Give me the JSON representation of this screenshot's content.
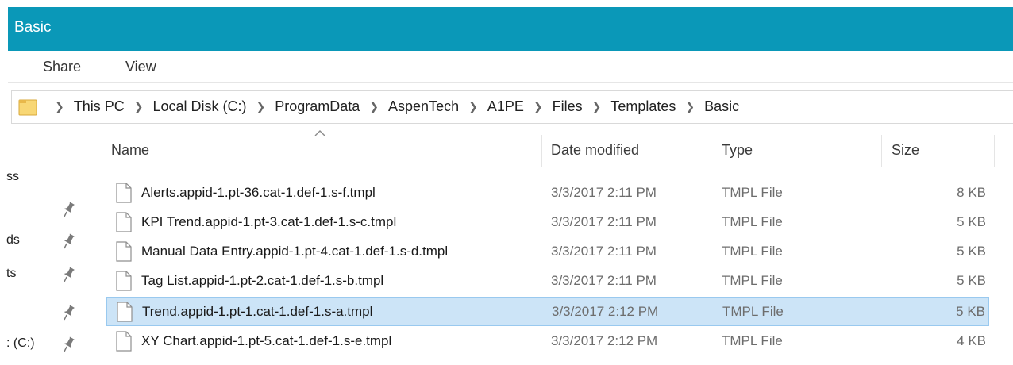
{
  "window": {
    "title": "Basic"
  },
  "ribbon": {
    "tabs": [
      "Share",
      "View"
    ]
  },
  "address": {
    "crumbs": [
      "This PC",
      "Local Disk (C:)",
      "ProgramData",
      "AspenTech",
      "A1PE",
      "Files",
      "Templates",
      "Basic"
    ]
  },
  "nav": {
    "items": [
      {
        "label": "ss",
        "pinned": false
      },
      {
        "label": "",
        "pinned": true
      },
      {
        "label": "ds",
        "pinned": true
      },
      {
        "label": "ts",
        "pinned": true
      },
      {
        "label": "",
        "pinned": true
      },
      {
        "label": ": (C:)",
        "pinned": true
      }
    ]
  },
  "columns": {
    "name": "Name",
    "date": "Date modified",
    "type": "Type",
    "size": "Size"
  },
  "files": [
    {
      "name": "Alerts.appid-1.pt-36.cat-1.def-1.s-f.tmpl",
      "date": "3/3/2017 2:11 PM",
      "type": "TMPL File",
      "size": "8 KB",
      "selected": false
    },
    {
      "name": "KPI Trend.appid-1.pt-3.cat-1.def-1.s-c.tmpl",
      "date": "3/3/2017 2:11 PM",
      "type": "TMPL File",
      "size": "5 KB",
      "selected": false
    },
    {
      "name": "Manual Data Entry.appid-1.pt-4.cat-1.def-1.s-d.tmpl",
      "date": "3/3/2017 2:11 PM",
      "type": "TMPL File",
      "size": "5 KB",
      "selected": false
    },
    {
      "name": "Tag List.appid-1.pt-2.cat-1.def-1.s-b.tmpl",
      "date": "3/3/2017 2:11 PM",
      "type": "TMPL File",
      "size": "5 KB",
      "selected": false
    },
    {
      "name": "Trend.appid-1.pt-1.cat-1.def-1.s-a.tmpl",
      "date": "3/3/2017 2:12 PM",
      "type": "TMPL File",
      "size": "5 KB",
      "selected": true
    },
    {
      "name": "XY Chart.appid-1.pt-5.cat-1.def-1.s-e.tmpl",
      "date": "3/3/2017 2:12 PM",
      "type": "TMPL File",
      "size": "4 KB",
      "selected": false
    }
  ],
  "colors": {
    "titlebar": "#0a98b8",
    "selection": "#cce4f7",
    "selection_border": "#99c9ef"
  },
  "icons": {
    "folder": "folder-icon",
    "file": "file-icon",
    "pin": "pin-icon",
    "separator": "chevron-right-icon",
    "sort": "chevron-up-icon"
  }
}
